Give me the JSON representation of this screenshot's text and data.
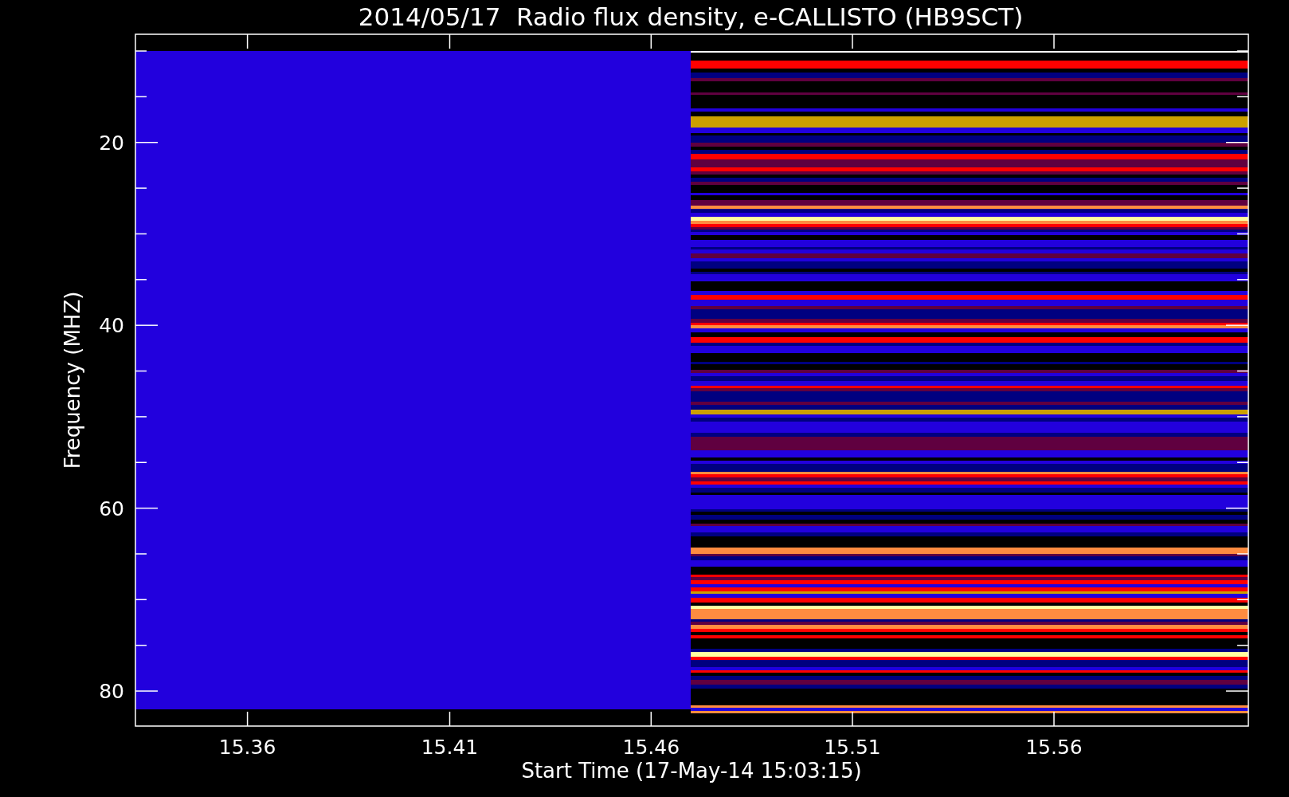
{
  "title": "2014/05/17  Radio flux density, e-CALLISTO (HB9SCT)",
  "plot": {
    "ylabel": "Frequency (MHZ)",
    "xlabel": "Start Time (17-May-14 15:03:15)",
    "yticks": [
      "20",
      "40",
      "60",
      "80"
    ],
    "xticks": [
      "15.36",
      "15.41",
      "15.46",
      "15.51",
      "15.56"
    ]
  }
}
